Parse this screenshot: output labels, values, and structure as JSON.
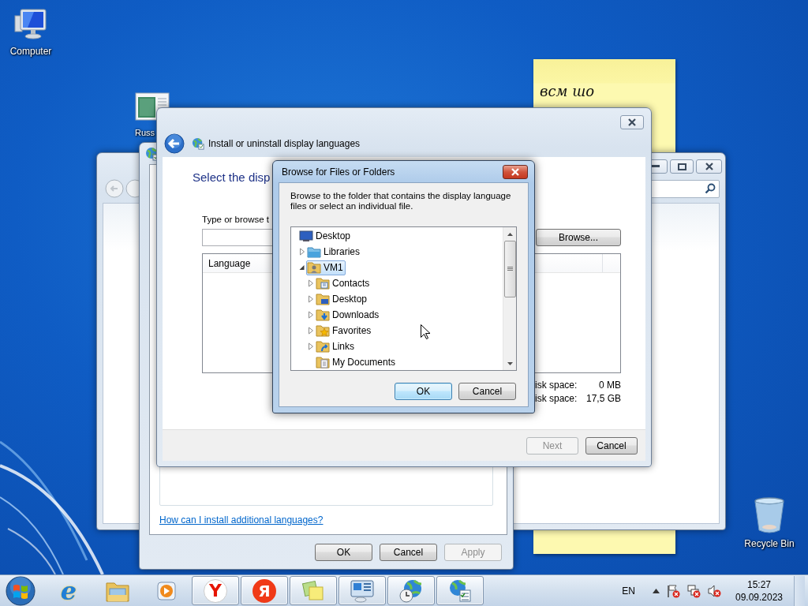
{
  "desktop_icons": [
    {
      "kind": "computer",
      "label": "Computer"
    },
    {
      "kind": "document",
      "label": "Russ"
    },
    {
      "kind": "recycle-bin",
      "label": "Recycle Bin"
    }
  ],
  "sticky_note": {
    "text": "всм шо"
  },
  "region_dialog": {
    "link": "How can I install additional languages?",
    "buttons": [
      {
        "label": "OK",
        "disabled": false
      },
      {
        "label": "Cancel",
        "disabled": false
      },
      {
        "label": "Apply",
        "disabled": true
      }
    ]
  },
  "install_window": {
    "title": "Install or uninstall display languages",
    "heading": "Select the disp",
    "prompt": "Type or browse t",
    "browse_button": "Browse...",
    "list_header": "Language",
    "disk_space": [
      {
        "label": "isk space:",
        "value": "0 MB"
      },
      {
        "label": "isk space:",
        "value": "17,5 GB"
      }
    ],
    "buttons": [
      {
        "label": "Next",
        "disabled": true
      },
      {
        "label": "Cancel",
        "disabled": false
      }
    ]
  },
  "browse_dialog": {
    "title": "Browse for Files or Folders",
    "instructions": "Browse to the folder that contains the display language files or select an individual file.",
    "tree": [
      {
        "label": "Desktop",
        "kind": "desktop",
        "expandable": false,
        "selected": false,
        "children": [
          {
            "label": "Libraries",
            "kind": "libraries",
            "expandable": true,
            "expanded": false,
            "selected": false
          },
          {
            "label": "VM1",
            "kind": "user",
            "expandable": true,
            "expanded": true,
            "selected": true,
            "children": [
              {
                "label": "Contacts",
                "kind": "contacts",
                "expandable": true,
                "expanded": false,
                "selected": false
              },
              {
                "label": "Desktop",
                "kind": "desktop-folder",
                "expandable": true,
                "expanded": false,
                "selected": false
              },
              {
                "label": "Downloads",
                "kind": "downloads",
                "expandable": true,
                "expanded": false,
                "selected": false
              },
              {
                "label": "Favorites",
                "kind": "favorites",
                "expandable": true,
                "expanded": false,
                "selected": false
              },
              {
                "label": "Links",
                "kind": "links",
                "expandable": true,
                "expanded": false,
                "selected": false
              },
              {
                "label": "My Documents",
                "kind": "documents",
                "expandable": false,
                "selected": false
              }
            ]
          }
        ]
      }
    ],
    "buttons": [
      {
        "label": "OK",
        "default": true
      },
      {
        "label": "Cancel",
        "default": false
      }
    ]
  },
  "taskbar": {
    "apps": [
      {
        "kind": "ie",
        "glyph": "e",
        "running": false
      },
      {
        "kind": "explorer",
        "running": false
      },
      {
        "kind": "media",
        "running": false
      },
      {
        "kind": "yandex-browser",
        "glyph": "Y",
        "running": true
      },
      {
        "kind": "yandex",
        "glyph": "Я",
        "running": true
      },
      {
        "kind": "sticky",
        "running": true
      },
      {
        "kind": "control-panel",
        "running": true
      },
      {
        "kind": "clock-globe",
        "running": true
      },
      {
        "kind": "region-globe",
        "running": true
      }
    ],
    "language": "EN",
    "time": "15:27",
    "date": "09.09.2023"
  }
}
